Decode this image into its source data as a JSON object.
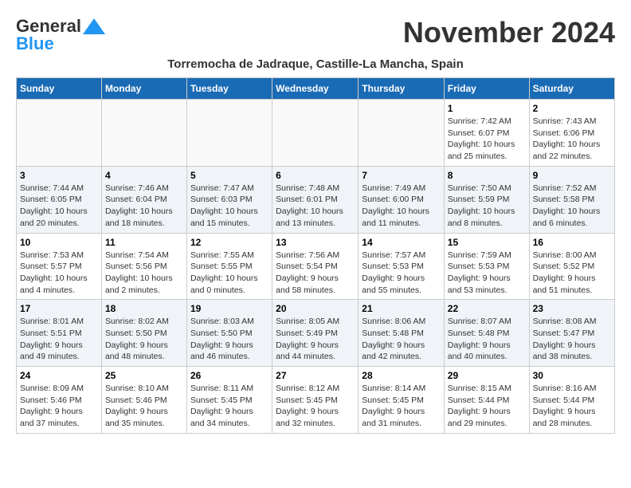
{
  "header": {
    "logo_general": "General",
    "logo_blue": "Blue",
    "month_title": "November 2024",
    "subtitle": "Torremocha de Jadraque, Castille-La Mancha, Spain"
  },
  "weekdays": [
    "Sunday",
    "Monday",
    "Tuesday",
    "Wednesday",
    "Thursday",
    "Friday",
    "Saturday"
  ],
  "weeks": [
    [
      {
        "day": "",
        "info": ""
      },
      {
        "day": "",
        "info": ""
      },
      {
        "day": "",
        "info": ""
      },
      {
        "day": "",
        "info": ""
      },
      {
        "day": "",
        "info": ""
      },
      {
        "day": "1",
        "info": "Sunrise: 7:42 AM\nSunset: 6:07 PM\nDaylight: 10 hours and 25 minutes."
      },
      {
        "day": "2",
        "info": "Sunrise: 7:43 AM\nSunset: 6:06 PM\nDaylight: 10 hours and 22 minutes."
      }
    ],
    [
      {
        "day": "3",
        "info": "Sunrise: 7:44 AM\nSunset: 6:05 PM\nDaylight: 10 hours and 20 minutes."
      },
      {
        "day": "4",
        "info": "Sunrise: 7:46 AM\nSunset: 6:04 PM\nDaylight: 10 hours and 18 minutes."
      },
      {
        "day": "5",
        "info": "Sunrise: 7:47 AM\nSunset: 6:03 PM\nDaylight: 10 hours and 15 minutes."
      },
      {
        "day": "6",
        "info": "Sunrise: 7:48 AM\nSunset: 6:01 PM\nDaylight: 10 hours and 13 minutes."
      },
      {
        "day": "7",
        "info": "Sunrise: 7:49 AM\nSunset: 6:00 PM\nDaylight: 10 hours and 11 minutes."
      },
      {
        "day": "8",
        "info": "Sunrise: 7:50 AM\nSunset: 5:59 PM\nDaylight: 10 hours and 8 minutes."
      },
      {
        "day": "9",
        "info": "Sunrise: 7:52 AM\nSunset: 5:58 PM\nDaylight: 10 hours and 6 minutes."
      }
    ],
    [
      {
        "day": "10",
        "info": "Sunrise: 7:53 AM\nSunset: 5:57 PM\nDaylight: 10 hours and 4 minutes."
      },
      {
        "day": "11",
        "info": "Sunrise: 7:54 AM\nSunset: 5:56 PM\nDaylight: 10 hours and 2 minutes."
      },
      {
        "day": "12",
        "info": "Sunrise: 7:55 AM\nSunset: 5:55 PM\nDaylight: 10 hours and 0 minutes."
      },
      {
        "day": "13",
        "info": "Sunrise: 7:56 AM\nSunset: 5:54 PM\nDaylight: 9 hours and 58 minutes."
      },
      {
        "day": "14",
        "info": "Sunrise: 7:57 AM\nSunset: 5:53 PM\nDaylight: 9 hours and 55 minutes."
      },
      {
        "day": "15",
        "info": "Sunrise: 7:59 AM\nSunset: 5:53 PM\nDaylight: 9 hours and 53 minutes."
      },
      {
        "day": "16",
        "info": "Sunrise: 8:00 AM\nSunset: 5:52 PM\nDaylight: 9 hours and 51 minutes."
      }
    ],
    [
      {
        "day": "17",
        "info": "Sunrise: 8:01 AM\nSunset: 5:51 PM\nDaylight: 9 hours and 49 minutes."
      },
      {
        "day": "18",
        "info": "Sunrise: 8:02 AM\nSunset: 5:50 PM\nDaylight: 9 hours and 48 minutes."
      },
      {
        "day": "19",
        "info": "Sunrise: 8:03 AM\nSunset: 5:50 PM\nDaylight: 9 hours and 46 minutes."
      },
      {
        "day": "20",
        "info": "Sunrise: 8:05 AM\nSunset: 5:49 PM\nDaylight: 9 hours and 44 minutes."
      },
      {
        "day": "21",
        "info": "Sunrise: 8:06 AM\nSunset: 5:48 PM\nDaylight: 9 hours and 42 minutes."
      },
      {
        "day": "22",
        "info": "Sunrise: 8:07 AM\nSunset: 5:48 PM\nDaylight: 9 hours and 40 minutes."
      },
      {
        "day": "23",
        "info": "Sunrise: 8:08 AM\nSunset: 5:47 PM\nDaylight: 9 hours and 38 minutes."
      }
    ],
    [
      {
        "day": "24",
        "info": "Sunrise: 8:09 AM\nSunset: 5:46 PM\nDaylight: 9 hours and 37 minutes."
      },
      {
        "day": "25",
        "info": "Sunrise: 8:10 AM\nSunset: 5:46 PM\nDaylight: 9 hours and 35 minutes."
      },
      {
        "day": "26",
        "info": "Sunrise: 8:11 AM\nSunset: 5:45 PM\nDaylight: 9 hours and 34 minutes."
      },
      {
        "day": "27",
        "info": "Sunrise: 8:12 AM\nSunset: 5:45 PM\nDaylight: 9 hours and 32 minutes."
      },
      {
        "day": "28",
        "info": "Sunrise: 8:14 AM\nSunset: 5:45 PM\nDaylight: 9 hours and 31 minutes."
      },
      {
        "day": "29",
        "info": "Sunrise: 8:15 AM\nSunset: 5:44 PM\nDaylight: 9 hours and 29 minutes."
      },
      {
        "day": "30",
        "info": "Sunrise: 8:16 AM\nSunset: 5:44 PM\nDaylight: 9 hours and 28 minutes."
      }
    ]
  ]
}
